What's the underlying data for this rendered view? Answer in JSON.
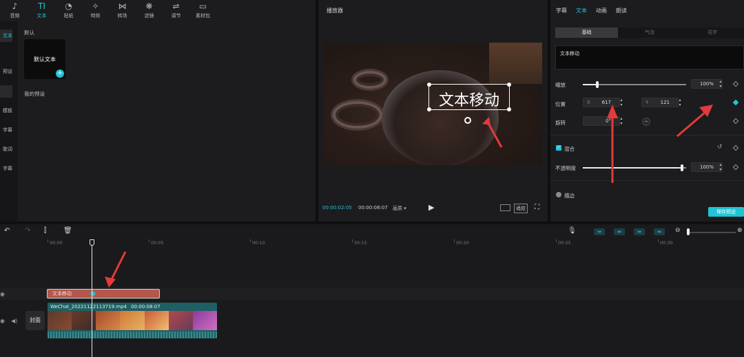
{
  "toolbar": {
    "tools": [
      {
        "label": "音频",
        "icon": "audio-icon",
        "glyph": "♪"
      },
      {
        "label": "文本",
        "icon": "text-icon",
        "glyph": "TI"
      },
      {
        "label": "贴纸",
        "icon": "sticker-icon",
        "glyph": "◔"
      },
      {
        "label": "特效",
        "icon": "effects-icon",
        "glyph": "✧"
      },
      {
        "label": "转场",
        "icon": "transition-icon",
        "glyph": "⋈"
      },
      {
        "label": "滤镜",
        "icon": "filter-icon",
        "glyph": "❋"
      },
      {
        "label": "调节",
        "icon": "adjust-icon",
        "glyph": "⇌"
      },
      {
        "label": "素材包",
        "icon": "asset-pack-icon",
        "glyph": "▭"
      }
    ],
    "active_index": 1
  },
  "side": {
    "items": [
      "文本",
      "预设",
      "",
      "模板",
      "字幕",
      "歌词",
      "字幕"
    ]
  },
  "left": {
    "default_label": "默认",
    "preset_card_label": "默认文本",
    "my_presets_label": "我的预设"
  },
  "player": {
    "title": "播放器",
    "overlay_text": "文本移动",
    "time_current": "00:00:02:05",
    "time_total": "00:00:08:07",
    "quality": "画质 ▾",
    "fit_label": "适应"
  },
  "right": {
    "tabs": [
      "字幕",
      "文本",
      "动画",
      "朗读"
    ],
    "active_tab": 1,
    "subtabs": [
      "基础",
      "气泡",
      "花字"
    ],
    "text_value": "文本移动",
    "scale": {
      "label": "缩放",
      "value": "100%",
      "level": 0.14
    },
    "position": {
      "label": "位置",
      "x_label": "X",
      "x": "617",
      "y_label": "Y",
      "y": "121"
    },
    "rotation": {
      "label": "旋转",
      "value": "0°"
    },
    "blend": {
      "label": "混合"
    },
    "opacity": {
      "label": "不透明度",
      "value": "100%",
      "level": 1.0
    },
    "stroke": {
      "label": "描边"
    },
    "save_preset": "保存预设"
  },
  "timeline": {
    "ticks": [
      "00:00",
      "00:05",
      "00:10",
      "00:15",
      "00:20",
      "00:25",
      "00:30"
    ],
    "text_clip_label": "文本移动",
    "video_clip_name": "WeChat_20221122113719.mp4",
    "video_clip_duration": "00:00:08:07",
    "cover_label": "封面"
  },
  "colors": {
    "accent": "#22c4d4",
    "text_clip": "#b4574c",
    "video_clip": "#1e5f63",
    "arrow": "#e23b3b"
  }
}
